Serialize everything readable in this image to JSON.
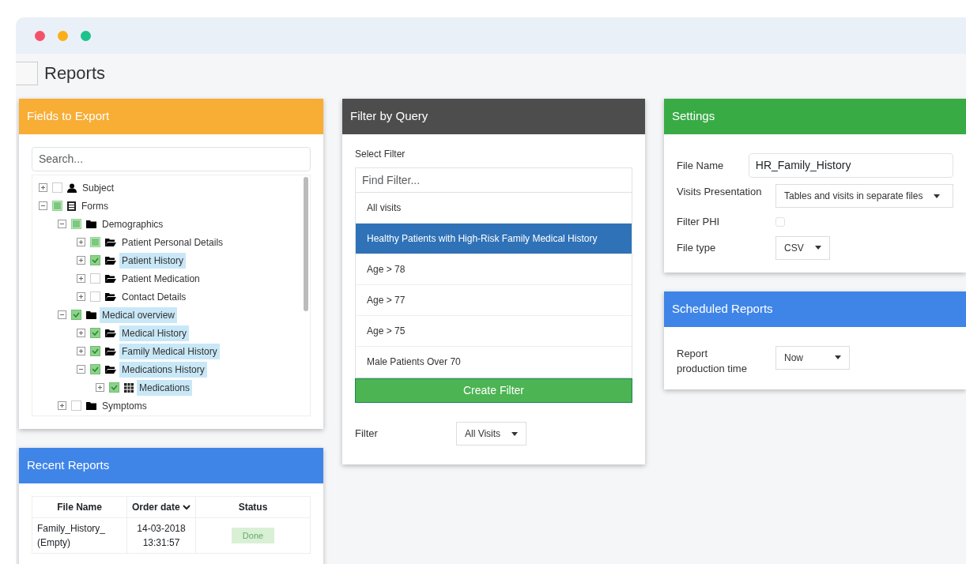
{
  "window": {
    "title": "Reports"
  },
  "fields_panel": {
    "title": "Fields to Export",
    "search_placeholder": "Search...",
    "tree": [
      {
        "label": "Subject",
        "kind": "person",
        "checked": false,
        "partial": false,
        "expanded": false,
        "selected": false
      },
      {
        "label": "Forms",
        "kind": "form",
        "checked": false,
        "partial": true,
        "expanded": true,
        "selected": false,
        "children": [
          {
            "label": "Demographics",
            "kind": "folder",
            "checked": false,
            "partial": true,
            "expanded": true,
            "selected": false,
            "children": [
              {
                "label": "Patient Personal Details",
                "kind": "page",
                "checked": false,
                "partial": true,
                "expanded": false,
                "selected": false
              },
              {
                "label": "Patient History",
                "kind": "page",
                "checked": true,
                "partial": false,
                "expanded": false,
                "selected": true
              },
              {
                "label": "Patient Medication",
                "kind": "page",
                "checked": false,
                "partial": false,
                "expanded": false,
                "selected": false
              },
              {
                "label": "Contact Details",
                "kind": "page",
                "checked": false,
                "partial": false,
                "expanded": false,
                "selected": false
              }
            ]
          },
          {
            "label": "Medical overview",
            "kind": "folder",
            "checked": true,
            "partial": false,
            "expanded": true,
            "selected": true,
            "children": [
              {
                "label": "Medical History",
                "kind": "page",
                "checked": true,
                "partial": false,
                "expanded": false,
                "selected": true
              },
              {
                "label": "Family Medical History",
                "kind": "page",
                "checked": true,
                "partial": false,
                "expanded": false,
                "selected": true
              },
              {
                "label": "Medications History",
                "kind": "page",
                "checked": true,
                "partial": false,
                "expanded": true,
                "selected": true,
                "children": [
                  {
                    "label": "Medications",
                    "kind": "grid",
                    "checked": true,
                    "partial": false,
                    "expanded": false,
                    "selected": true
                  }
                ]
              }
            ]
          },
          {
            "label": "Symptoms",
            "kind": "folder",
            "checked": false,
            "partial": false,
            "expanded": false,
            "selected": false
          }
        ]
      }
    ]
  },
  "recent_reports": {
    "title": "Recent Reports",
    "columns": [
      "File Name",
      "Order date",
      "Status"
    ],
    "rows": [
      {
        "file_name": "Family_History_ (Empty)",
        "order_date": "14-03-2018 13:31:57",
        "status": "Done"
      }
    ]
  },
  "filter_panel": {
    "title": "Filter by Query",
    "select_label": "Select Filter",
    "find_placeholder": "Find Filter...",
    "options": [
      {
        "label": "All visits",
        "selected": false
      },
      {
        "label": "Healthy Patients with High-Risk Family Medical History",
        "selected": true
      },
      {
        "label": "Age > 78",
        "selected": false
      },
      {
        "label": "Age > 77",
        "selected": false
      },
      {
        "label": "Age > 75",
        "selected": false
      },
      {
        "label": "Male Patients Over 70",
        "selected": false
      }
    ],
    "create_button": "Create Filter",
    "filter_label": "Filter",
    "filter_value": "All Visits"
  },
  "settings": {
    "title": "Settings",
    "file_name_label": "File Name",
    "file_name_value": "HR_Family_History",
    "visits_label": "Visits Presentation",
    "visits_value": "Tables and visits in separate files",
    "phi_label": "Filter PHI",
    "phi_checked": false,
    "file_type_label": "File type",
    "file_type_value": "CSV"
  },
  "scheduled": {
    "title": "Scheduled Reports",
    "time_label": "Report production time",
    "time_value": "Now"
  }
}
